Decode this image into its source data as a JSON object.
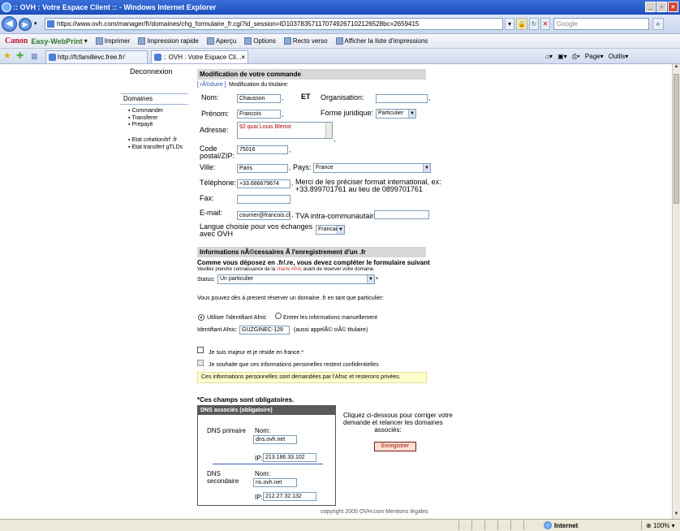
{
  "window": {
    "title": ":: OVH : Votre Espace Client :: - Windows Internet Explorer"
  },
  "address": {
    "url": "https://www.ovh.com/manager/fr/domaines/chg_formulaire_fr.cgi?id_session=ID103783571170749267102126528bc=2659415",
    "search_placeholder": "Google"
  },
  "canon_toolbar": {
    "brand": "Canon",
    "product": "Easy-WebPrint",
    "items": [
      "Imprimer",
      "Impression rapide",
      "Aperçu",
      "Options",
      "Recto verso",
      "Afficher la liste d'impressions"
    ]
  },
  "tabs": [
    {
      "label": "http://fcfamillevc.free.fr/"
    },
    {
      "label": ":: OVH : Votre Espace Cli..."
    }
  ],
  "command_bar": {
    "page": "Page",
    "tools": "Outils"
  },
  "leftnav": {
    "deconnexion": "Deconnexion",
    "domaines": "Domaines",
    "items1": [
      "Commander",
      "Transferer",
      "Prepayé"
    ],
    "items2": [
      "Etat création/trf .fr",
      "Etat transfert gTLDs"
    ]
  },
  "section1": {
    "title": "Modification de votre commande",
    "reduire_link": "[ rÃ©duire ]",
    "reduire_text": "Modification du titulaire:",
    "et_label": "ET",
    "nom_label": "Nom:",
    "nom_value": "Chausson",
    "prenom_label": "Prénom:",
    "prenom_value": "Francois",
    "organisation_label": "Organisation:",
    "organisation_value": "",
    "forme_label": "Forme juridique:",
    "forme_value": "Particulier",
    "adresse_label": "Adresse:",
    "adresse_value": "92 quai Louis Bleriot",
    "cp_label_1": "Code",
    "cp_label_2": "postal/ZIP:",
    "cp_value": "75016",
    "ville_label": "Ville:",
    "ville_value": "Paris",
    "pays_label": "Pays:",
    "pays_value": "France",
    "tel_label": "Téléphone:",
    "tel_value": "+33.686679674",
    "tel_note_1": "Merci de les préciser format international, ex:",
    "tel_note_2": "+33.899701761 au lieu de 0899701761",
    "fax_label": "Fax:",
    "fax_value": "",
    "email_label": "E-mail:",
    "email_value": "courrier@francois.ch",
    "tva_label": "TVA intra-communautaire:",
    "tva_value": "",
    "langue_label_1": "Langue choisie pour vos échanges",
    "langue_label_2": "avec OVH",
    "langue_value": "Francais"
  },
  "section2": {
    "title": "Informations nÃ©cessaires Ã  l'enregistrement d'un .fr",
    "bold_line": "Comme vous déposez en .fr/.re, vous devez compléter le formulaire suivant",
    "small_line_pre": "Veuillez prendre connaissance de la ",
    "small_line_link": "charte Afnic",
    "small_line_post": " avant de réserver votre domaine.",
    "status_label": "Status:",
    "status_value": "Un particulier",
    "reserve_line": "Vous pouvez dès à present réserver un domaine .fr en tant que particulier:",
    "radio1": "Utiliser l'identifiant Afnic",
    "radio2": "Entrer les informations manuellement",
    "ident_label": "Identifiant Afnic:",
    "ident_value": "GUZGINEC-129",
    "ident_note": "(aussi appelÃ© ciÃ© titulaire)",
    "check1": "Je suis majeur et je réside en france.*",
    "check2": "Je souhaite que ces informations personelles restent confidentielles",
    "notice": "Ces informations personnelles sont demandées par l'Afnic et resterons privées.",
    "required_note": "*Ces champs sont obligatoires."
  },
  "dns": {
    "title": "DNS associés (obligatoire)",
    "primary_label": "DNS primaire",
    "secondary_label_1": "DNS",
    "secondary_label_2": "secondaire",
    "nom_label": "Nom:",
    "ip_label": "IP:",
    "primary_nom": "dns.ovh.net",
    "primary_ip": "213.186.33.102",
    "secondary_nom": "ns.ovh.net",
    "secondary_ip": "212.27.32.132",
    "correct_text_1": "Cliquez ci-dessous pour corriger votre",
    "correct_text_2": "demande et relancer les domaines",
    "correct_text_3": "associés:",
    "save_button": "Enregistrer"
  },
  "footer": {
    "text": "copyright 2005 OVH.com  Mentions légales"
  },
  "statusbar": {
    "zone": "Internet",
    "zoom": "100%"
  }
}
